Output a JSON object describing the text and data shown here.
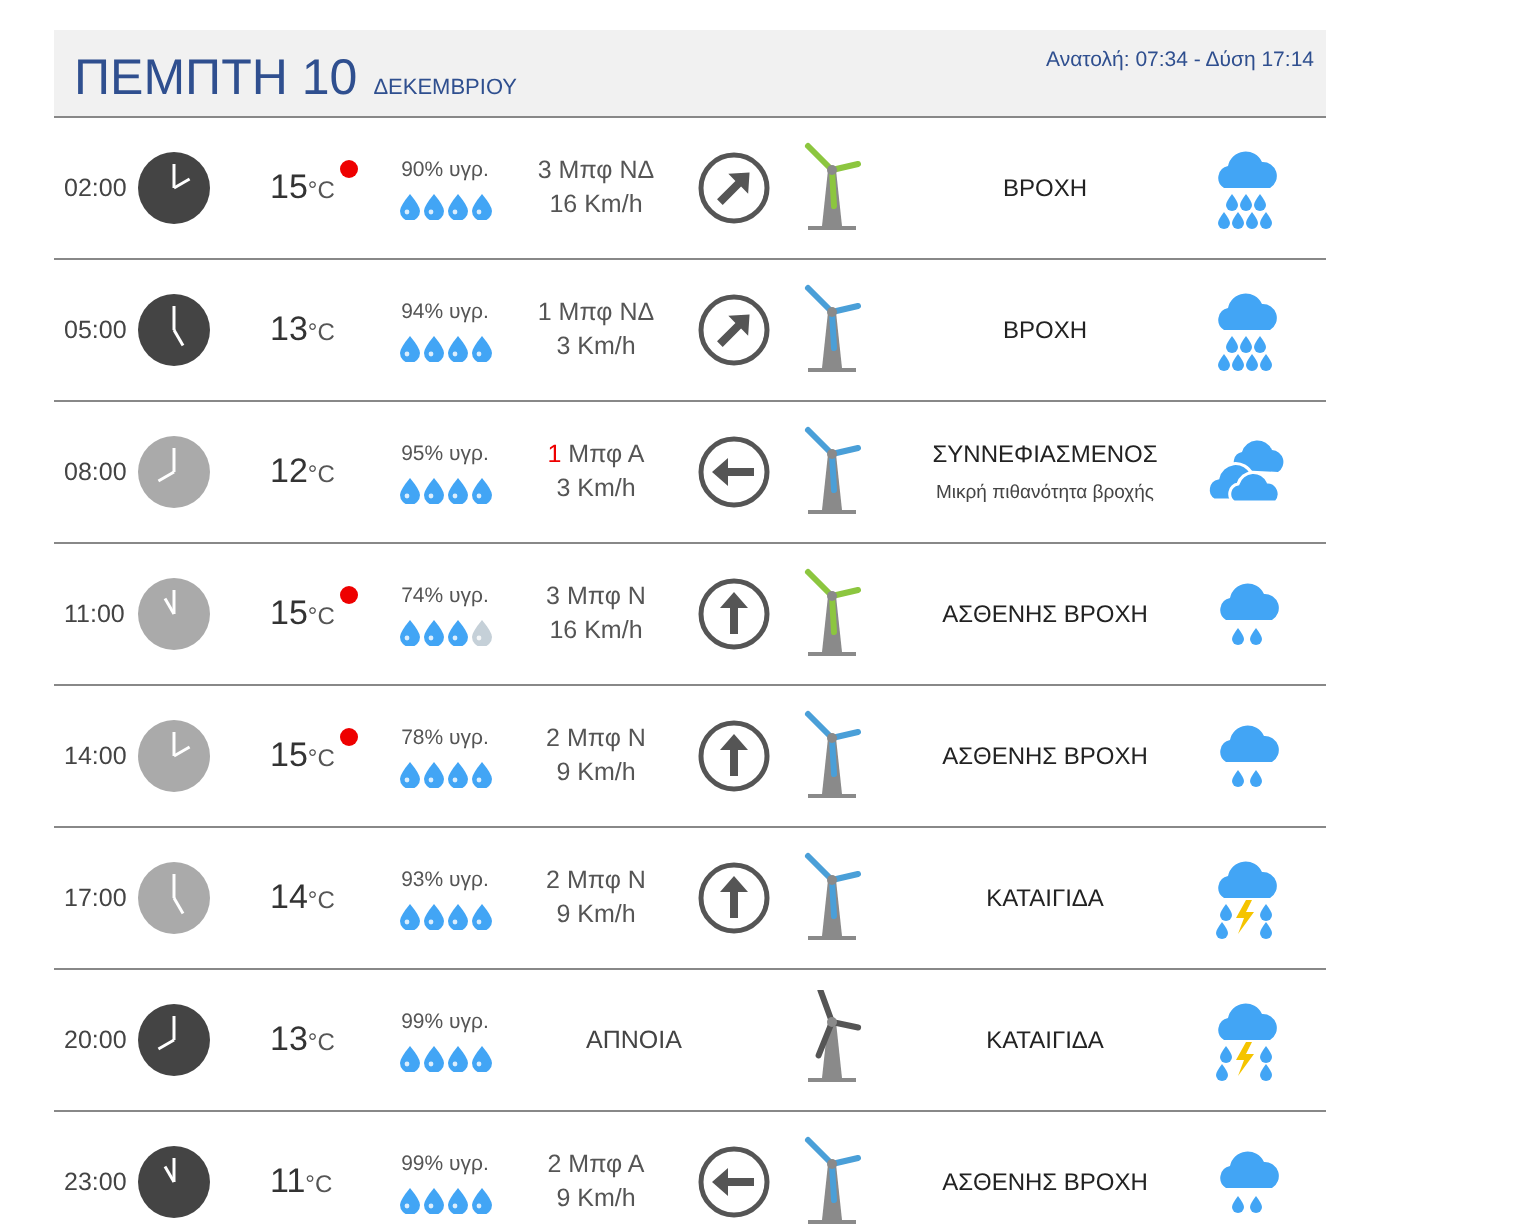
{
  "header": {
    "day": "ΠΕΜΠΤΗ 10",
    "month": "ΔΕΚΕΜΒΡΙΟΥ",
    "sun": "Ανατολή: 07:34  - Δύση 17:14"
  },
  "rows": [
    {
      "time": "02:00",
      "night": true,
      "temp": "15",
      "unit": "°C",
      "alert": true,
      "humidity": "90% υγρ.",
      "drops": [
        {
          "filled": true
        },
        {
          "filled": true
        },
        {
          "filled": true
        },
        {
          "filled": true
        }
      ],
      "wind": {
        "kind": "speed",
        "force": "3",
        "dir": "Μπφ ΝΔ",
        "force_alert": false,
        "speed": "16 Km/h",
        "arrow": {
          "kind": "northeast"
        }
      },
      "turbine": {
        "color": "#8cc63f"
      },
      "condition": "ΒΡΟΧΗ",
      "weather": {
        "kind": "rain"
      }
    },
    {
      "time": "05:00",
      "night": true,
      "temp": "13",
      "unit": "°C",
      "alert": false,
      "humidity": "94% υγρ.",
      "drops": [
        {
          "filled": true
        },
        {
          "filled": true
        },
        {
          "filled": true
        },
        {
          "filled": true
        }
      ],
      "wind": {
        "kind": "speed",
        "force": "1",
        "dir": "Μπφ ΝΔ",
        "force_alert": false,
        "speed": "3 Km/h",
        "arrow": {
          "kind": "northeast"
        }
      },
      "turbine": {
        "color": "#4a9fd8"
      },
      "condition": "ΒΡΟΧΗ",
      "weather": {
        "kind": "rain"
      }
    },
    {
      "time": "08:00",
      "night": false,
      "temp": "12",
      "unit": "°C",
      "alert": false,
      "humidity": "95% υγρ.",
      "drops": [
        {
          "filled": true
        },
        {
          "filled": true
        },
        {
          "filled": true
        },
        {
          "filled": true
        }
      ],
      "wind": {
        "kind": "speed",
        "force": "1",
        "dir": "Μπφ Α",
        "force_alert": true,
        "speed": "3 Km/h",
        "arrow": {
          "kind": "west"
        }
      },
      "turbine": {
        "color": "#4a9fd8"
      },
      "condition": "ΣΥΝΝΕΦΙΑΣΜΕΝΟΣ",
      "note": "Μικρή πιθανότητα βροχής",
      "weather": {
        "kind": "cloudy"
      }
    },
    {
      "time": "11:00",
      "night": false,
      "temp": "15",
      "unit": "°C",
      "alert": true,
      "humidity": "74% υγρ.",
      "drops": [
        {
          "filled": true
        },
        {
          "filled": true
        },
        {
          "filled": true
        },
        {
          "filled": false
        }
      ],
      "wind": {
        "kind": "speed",
        "force": "3",
        "dir": "Μπφ Ν",
        "force_alert": false,
        "speed": "16 Km/h",
        "arrow": {
          "kind": "north"
        }
      },
      "turbine": {
        "color": "#8cc63f"
      },
      "condition": "ΑΣΘΕΝΗΣ ΒΡΟΧΗ",
      "weather": {
        "kind": "light_rain"
      }
    },
    {
      "time": "14:00",
      "night": false,
      "temp": "15",
      "unit": "°C",
      "alert": true,
      "humidity": "78% υγρ.",
      "drops": [
        {
          "filled": true
        },
        {
          "filled": true
        },
        {
          "filled": true
        },
        {
          "filled": true
        }
      ],
      "wind": {
        "kind": "speed",
        "force": "2",
        "dir": "Μπφ Ν",
        "force_alert": false,
        "speed": "9 Km/h",
        "arrow": {
          "kind": "north"
        }
      },
      "turbine": {
        "color": "#4a9fd8"
      },
      "condition": "ΑΣΘΕΝΗΣ ΒΡΟΧΗ",
      "weather": {
        "kind": "light_rain"
      }
    },
    {
      "time": "17:00",
      "night": false,
      "temp": "14",
      "unit": "°C",
      "alert": false,
      "humidity": "93% υγρ.",
      "drops": [
        {
          "filled": true
        },
        {
          "filled": true
        },
        {
          "filled": true
        },
        {
          "filled": true
        }
      ],
      "wind": {
        "kind": "speed",
        "force": "2",
        "dir": "Μπφ Ν",
        "force_alert": false,
        "speed": "9 Km/h",
        "arrow": {
          "kind": "north"
        }
      },
      "turbine": {
        "color": "#4a9fd8"
      },
      "condition": "ΚΑΤΑΙΓΙΔΑ",
      "weather": {
        "kind": "storm"
      }
    },
    {
      "time": "20:00",
      "night": true,
      "temp": "13",
      "unit": "°C",
      "alert": false,
      "humidity": "99% υγρ.",
      "drops": [
        {
          "filled": true
        },
        {
          "filled": true
        },
        {
          "filled": true
        },
        {
          "filled": true
        }
      ],
      "wind": {
        "kind": "calm",
        "text": "ΑΠΝΟΙΑ"
      },
      "turbine": {
        "color": "#555555"
      },
      "condition": "ΚΑΤΑΙΓΙΔΑ",
      "weather": {
        "kind": "storm"
      }
    },
    {
      "time": "23:00",
      "night": true,
      "temp": "11",
      "unit": "°C",
      "alert": false,
      "humidity": "99% υγρ.",
      "drops": [
        {
          "filled": true
        },
        {
          "filled": true
        },
        {
          "filled": true
        },
        {
          "filled": true
        }
      ],
      "wind": {
        "kind": "speed",
        "force": "2",
        "dir": "Μπφ Α",
        "force_alert": false,
        "speed": "9 Km/h",
        "arrow": {
          "kind": "west"
        }
      },
      "turbine": {
        "color": "#4a9fd8"
      },
      "condition": "ΑΣΘΕΝΗΣ ΒΡΟΧΗ",
      "weather": {
        "kind": "light_rain"
      }
    }
  ]
}
